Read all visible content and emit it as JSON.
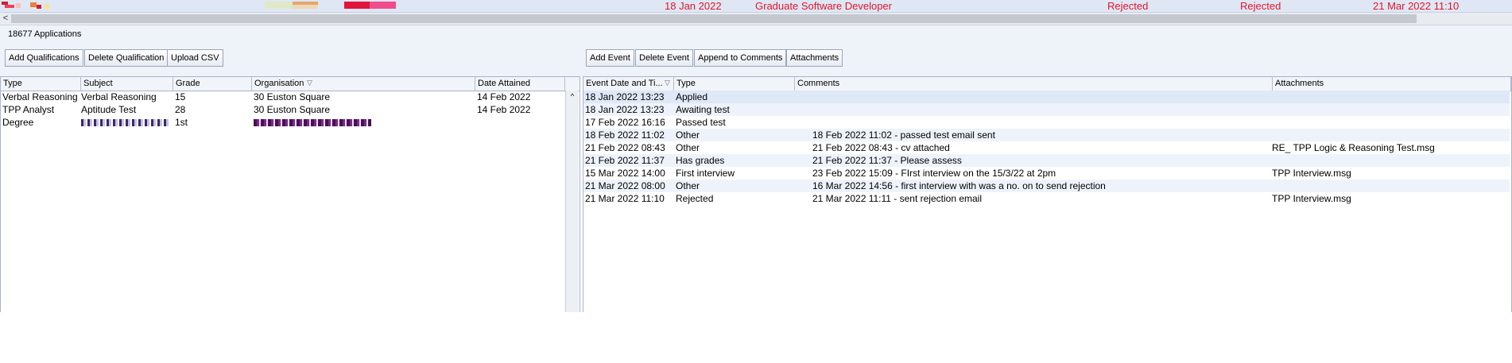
{
  "top_row": {
    "date": "18 Jan 2022",
    "role": "Graduate Software Developer",
    "status1": "Rejected",
    "status2": "Rejected",
    "updated": "21 Mar 2022 11:10"
  },
  "scroll": {
    "left_arrow": "<"
  },
  "applications": {
    "count_label": "18677 Applications"
  },
  "qual_toolbar": {
    "add": "Add Qualifications",
    "delete": "Delete Qualification",
    "upload": "Upload CSV"
  },
  "event_toolbar": {
    "add": "Add Event",
    "delete": "Delete Event",
    "append": "Append to Comments",
    "attachments": "Attachments"
  },
  "qualifications": {
    "columns": [
      "Type",
      "Subject",
      "Grade",
      "Organisation",
      "Date Attained"
    ],
    "rows": [
      [
        "Verbal Reasoning",
        "Verbal Reasoning",
        "15",
        "30 Euston Square",
        "14 Feb 2022"
      ],
      [
        "TPP Analyst",
        "Aptitude Test",
        "28",
        "30 Euston Square",
        "14 Feb 2022"
      ],
      [
        "Degree",
        "",
        "1st",
        "",
        ""
      ]
    ],
    "scroll_up": "^"
  },
  "events": {
    "columns": [
      "Event Date and Ti...",
      "Type",
      "Comments",
      "Attachments"
    ],
    "rows": [
      [
        "18 Jan 2022 13:23",
        "Applied",
        "",
        ""
      ],
      [
        "18 Jan 2022 13:23",
        "Awaiting test",
        "",
        ""
      ],
      [
        "17 Feb 2022 16:16",
        "Passed test",
        "",
        ""
      ],
      [
        "18 Feb 2022 11:02",
        "Other",
        "18 Feb 2022 11:02 - passed test email sent",
        ""
      ],
      [
        "21 Feb 2022 08:43",
        "Other",
        "21 Feb 2022 08:43 - cv attached",
        "RE_ TPP Logic & Reasoning Test.msg"
      ],
      [
        "21 Feb 2022 11:37",
        "Has grades",
        "21 Feb 2022 11:37 - Please assess",
        ""
      ],
      [
        "15 Mar 2022 14:00",
        "First interview",
        "23 Feb 2022 15:09 - FIrst interview on the 15/3/22 at 2pm",
        "TPP Interview.msg"
      ],
      [
        "21 Mar 2022 08:00",
        "Other",
        "16 Mar 2022 14:56 - first interview with        was a no. on to send rejection",
        ""
      ],
      [
        "21 Mar 2022 11:10",
        "Rejected",
        "21 Mar 2022 11:11 - sent rejection email",
        "TPP Interview.msg"
      ]
    ]
  },
  "colors": {
    "accent_red": "#e0162b",
    "selection": "#dfe8f6"
  }
}
